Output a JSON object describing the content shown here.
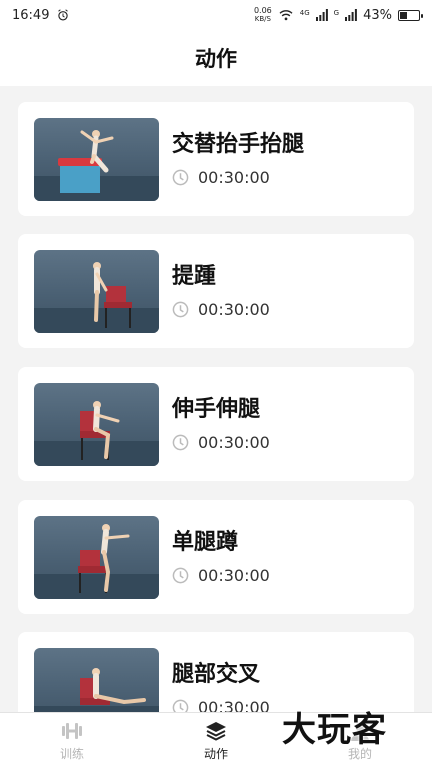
{
  "status_bar": {
    "time": "16:49",
    "net_speed_value": "0.06",
    "net_speed_unit": "KB/S",
    "signal_1": "4G",
    "signal_2": "G",
    "battery_percent": "43%",
    "battery_level": 0.43
  },
  "header": {
    "title": "动作"
  },
  "exercises": [
    {
      "title": "交替抬手抬腿",
      "duration": "00:30:00",
      "thumbnail": "exercise-thumbnail-box"
    },
    {
      "title": "提踵",
      "duration": "00:30:00",
      "thumbnail": "exercise-thumbnail-chair-standing"
    },
    {
      "title": "伸手伸腿",
      "duration": "00:30:00",
      "thumbnail": "exercise-thumbnail-chair-seated"
    },
    {
      "title": "单腿蹲",
      "duration": "00:30:00",
      "thumbnail": "exercise-thumbnail-chair-squat"
    },
    {
      "title": "腿部交叉",
      "duration": "00:30:00",
      "thumbnail": "exercise-thumbnail-chair-seated"
    }
  ],
  "tab_bar": {
    "tabs": [
      {
        "label": "训练",
        "icon": "dumbbell-icon",
        "active": false
      },
      {
        "label": "动作",
        "icon": "layers-icon",
        "active": true
      },
      {
        "label": "我的",
        "icon": "user-icon",
        "active": false
      }
    ]
  },
  "watermark": "大玩客",
  "colors": {
    "background": "#f3f3f3",
    "card": "#ffffff",
    "text": "#111111",
    "tab_inactive": "#b5b5b5"
  }
}
